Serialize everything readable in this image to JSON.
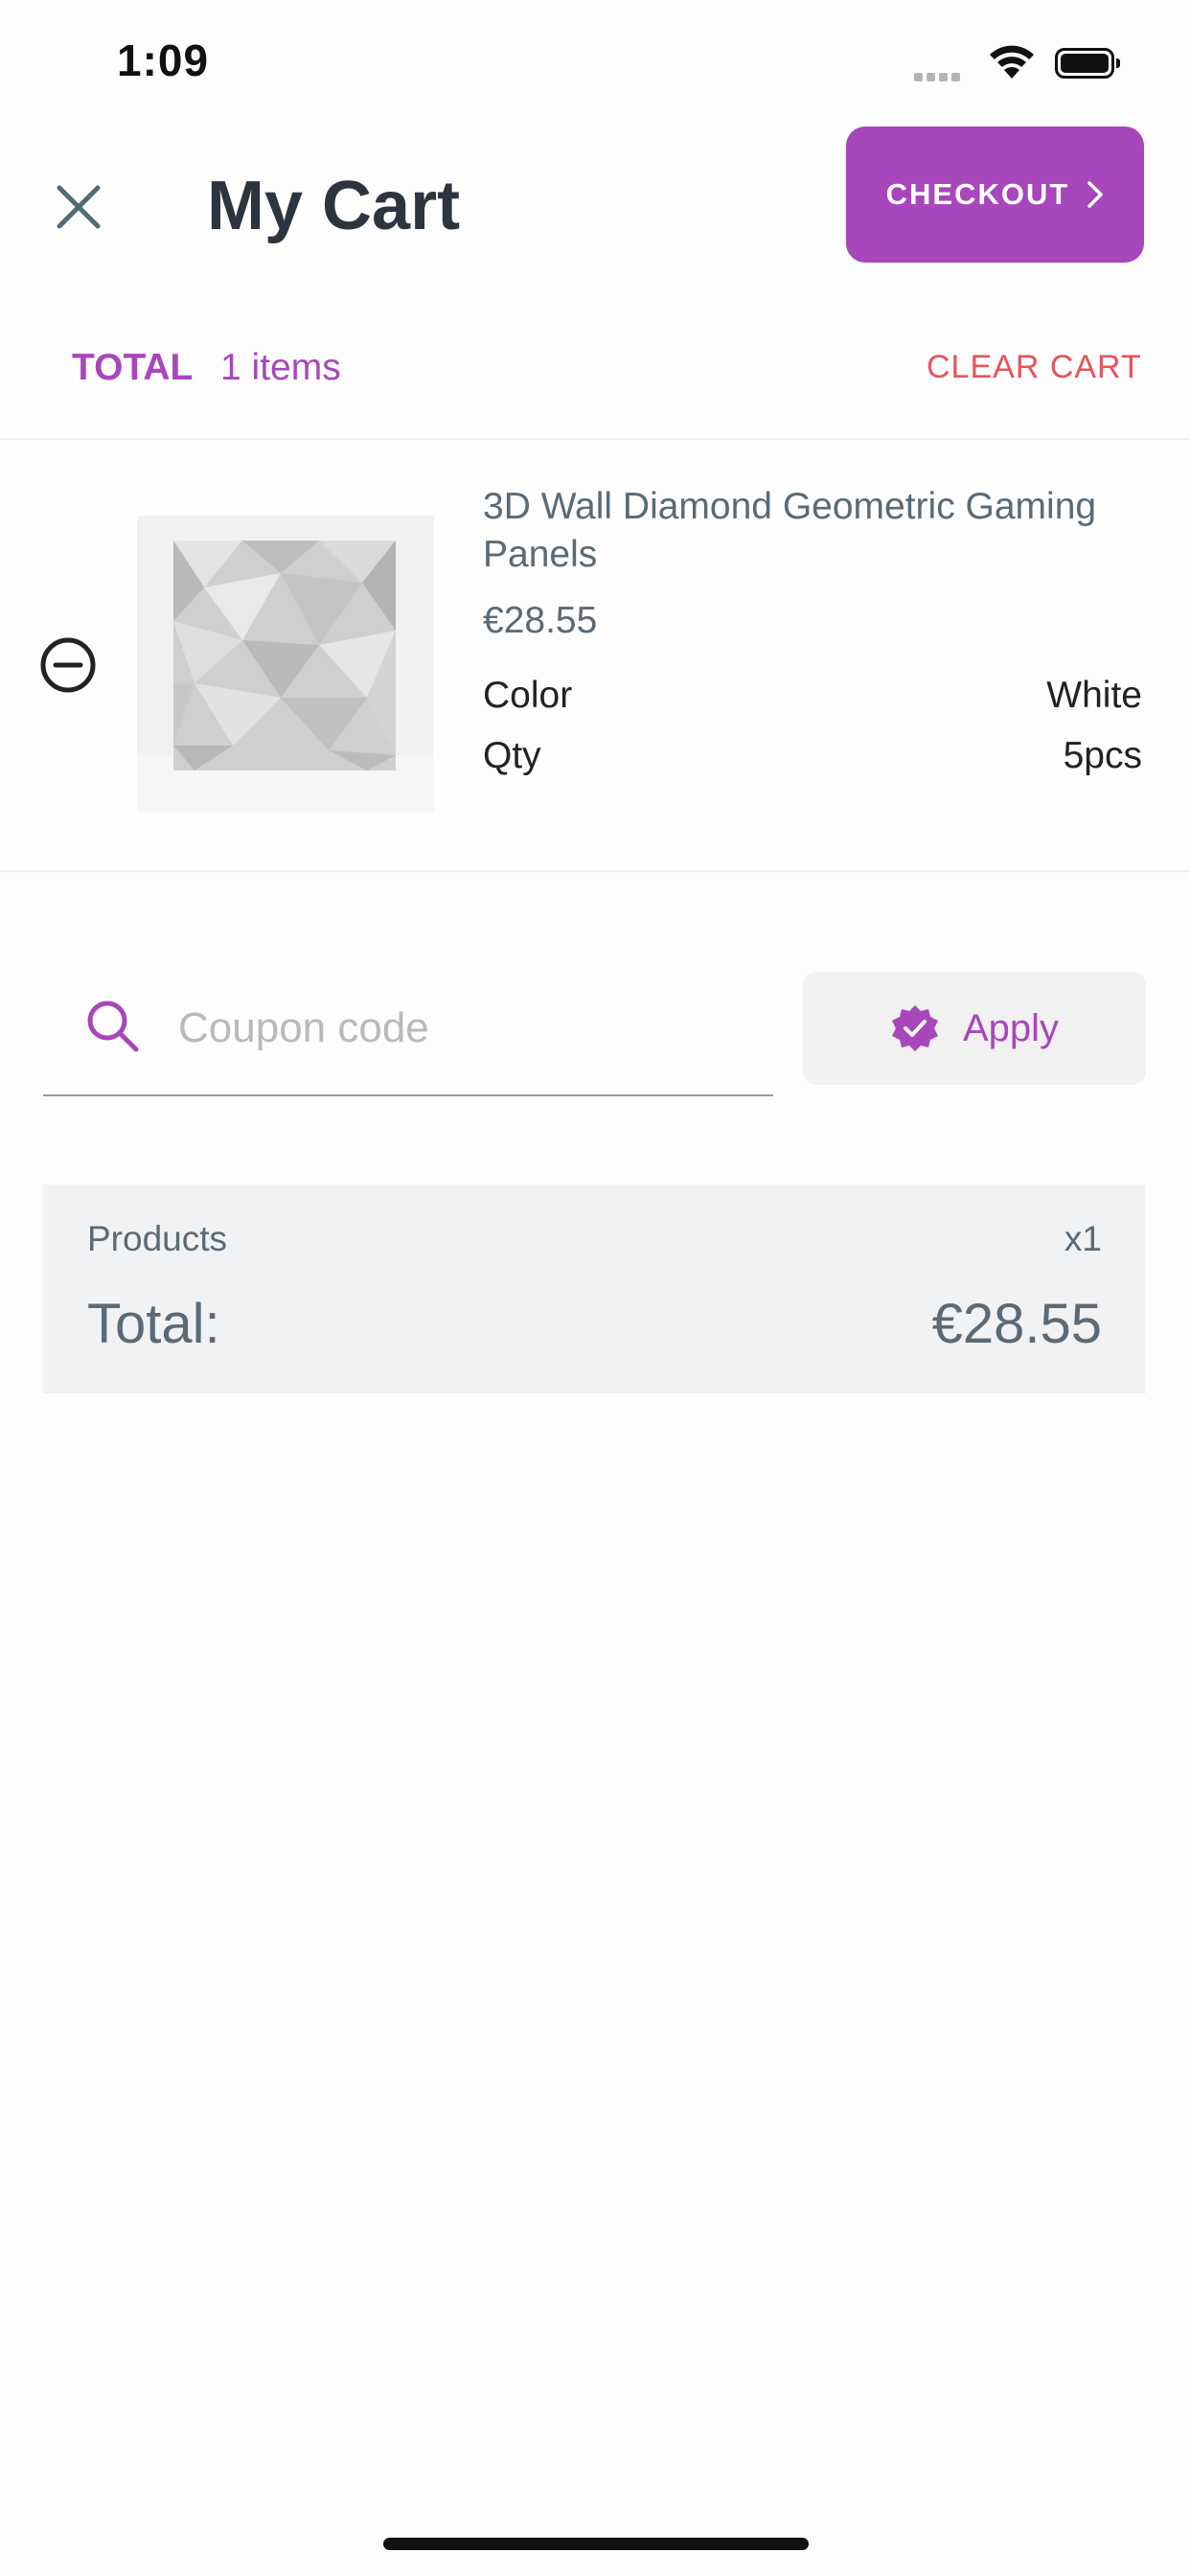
{
  "status_bar": {
    "time": "1:09"
  },
  "header": {
    "title": "My Cart",
    "checkout_label": "CHECKOUT",
    "total_label": "TOTAL",
    "items_count": "1 items",
    "clear_cart_label": "CLEAR CART"
  },
  "cart_items": [
    {
      "name": "3D Wall Diamond Geometric Gaming Panels",
      "price": "€28.55",
      "attributes": [
        {
          "label": "Color",
          "value": "White"
        },
        {
          "label": "Qty",
          "value": "5pcs"
        }
      ]
    }
  ],
  "coupon": {
    "placeholder": "Coupon code",
    "value": "",
    "apply_label": "Apply"
  },
  "summary": {
    "products_label": "Products",
    "products_count": "x1",
    "total_label": "Total:",
    "total_value": "€28.55"
  },
  "colors": {
    "accent": "#a846bb",
    "danger": "#e5545a",
    "text_muted": "#5a6a76"
  },
  "icons": {
    "close": "close-icon",
    "remove": "remove-circle-icon",
    "search": "search-icon",
    "apply": "verified-badge-icon",
    "checkout": "chevron-right-icon"
  }
}
